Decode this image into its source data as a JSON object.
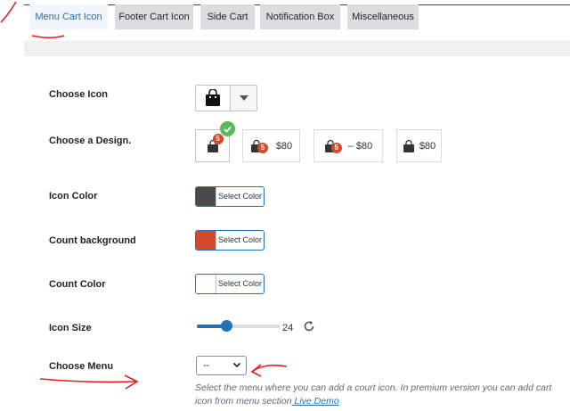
{
  "tabs": [
    {
      "label": "Menu Cart Icon",
      "active": true
    },
    {
      "label": "Footer Cart Icon",
      "active": false
    },
    {
      "label": "Side Cart",
      "active": false
    },
    {
      "label": "Notification Box",
      "active": false
    },
    {
      "label": "Miscellaneous",
      "active": false
    }
  ],
  "fields": {
    "choose_icon": "Choose Icon",
    "choose_design": "Choose a Design.",
    "icon_color": "Icon Color",
    "count_background": "Count background",
    "count_color": "Count Color",
    "icon_size": "Icon Size",
    "choose_menu": "Choose Menu"
  },
  "designs": [
    {
      "badge": "5",
      "price": "",
      "selected": true
    },
    {
      "badge": "5",
      "price": "$80",
      "selected": false
    },
    {
      "badge": "5",
      "price": "– $80",
      "selected": false
    },
    {
      "badge": "",
      "price": "$80",
      "selected": false
    }
  ],
  "colors": {
    "icon_color": {
      "swatch": "#4a4a4a",
      "label": "Select Color"
    },
    "count_background": {
      "swatch": "#d24a2c",
      "label": "Select Color"
    },
    "count_color": {
      "swatch": "#ffffff",
      "label": "Select Color"
    }
  },
  "icon_size": {
    "value": "24",
    "fraction": 0.36
  },
  "menu_select": {
    "value": "--"
  },
  "description": {
    "text": "Select the menu where you can add a court icon. In premium version you can add cart icon from menu section",
    "link": " Live Demo"
  },
  "accent": "#2271b1",
  "check_color": "#5cb85c"
}
